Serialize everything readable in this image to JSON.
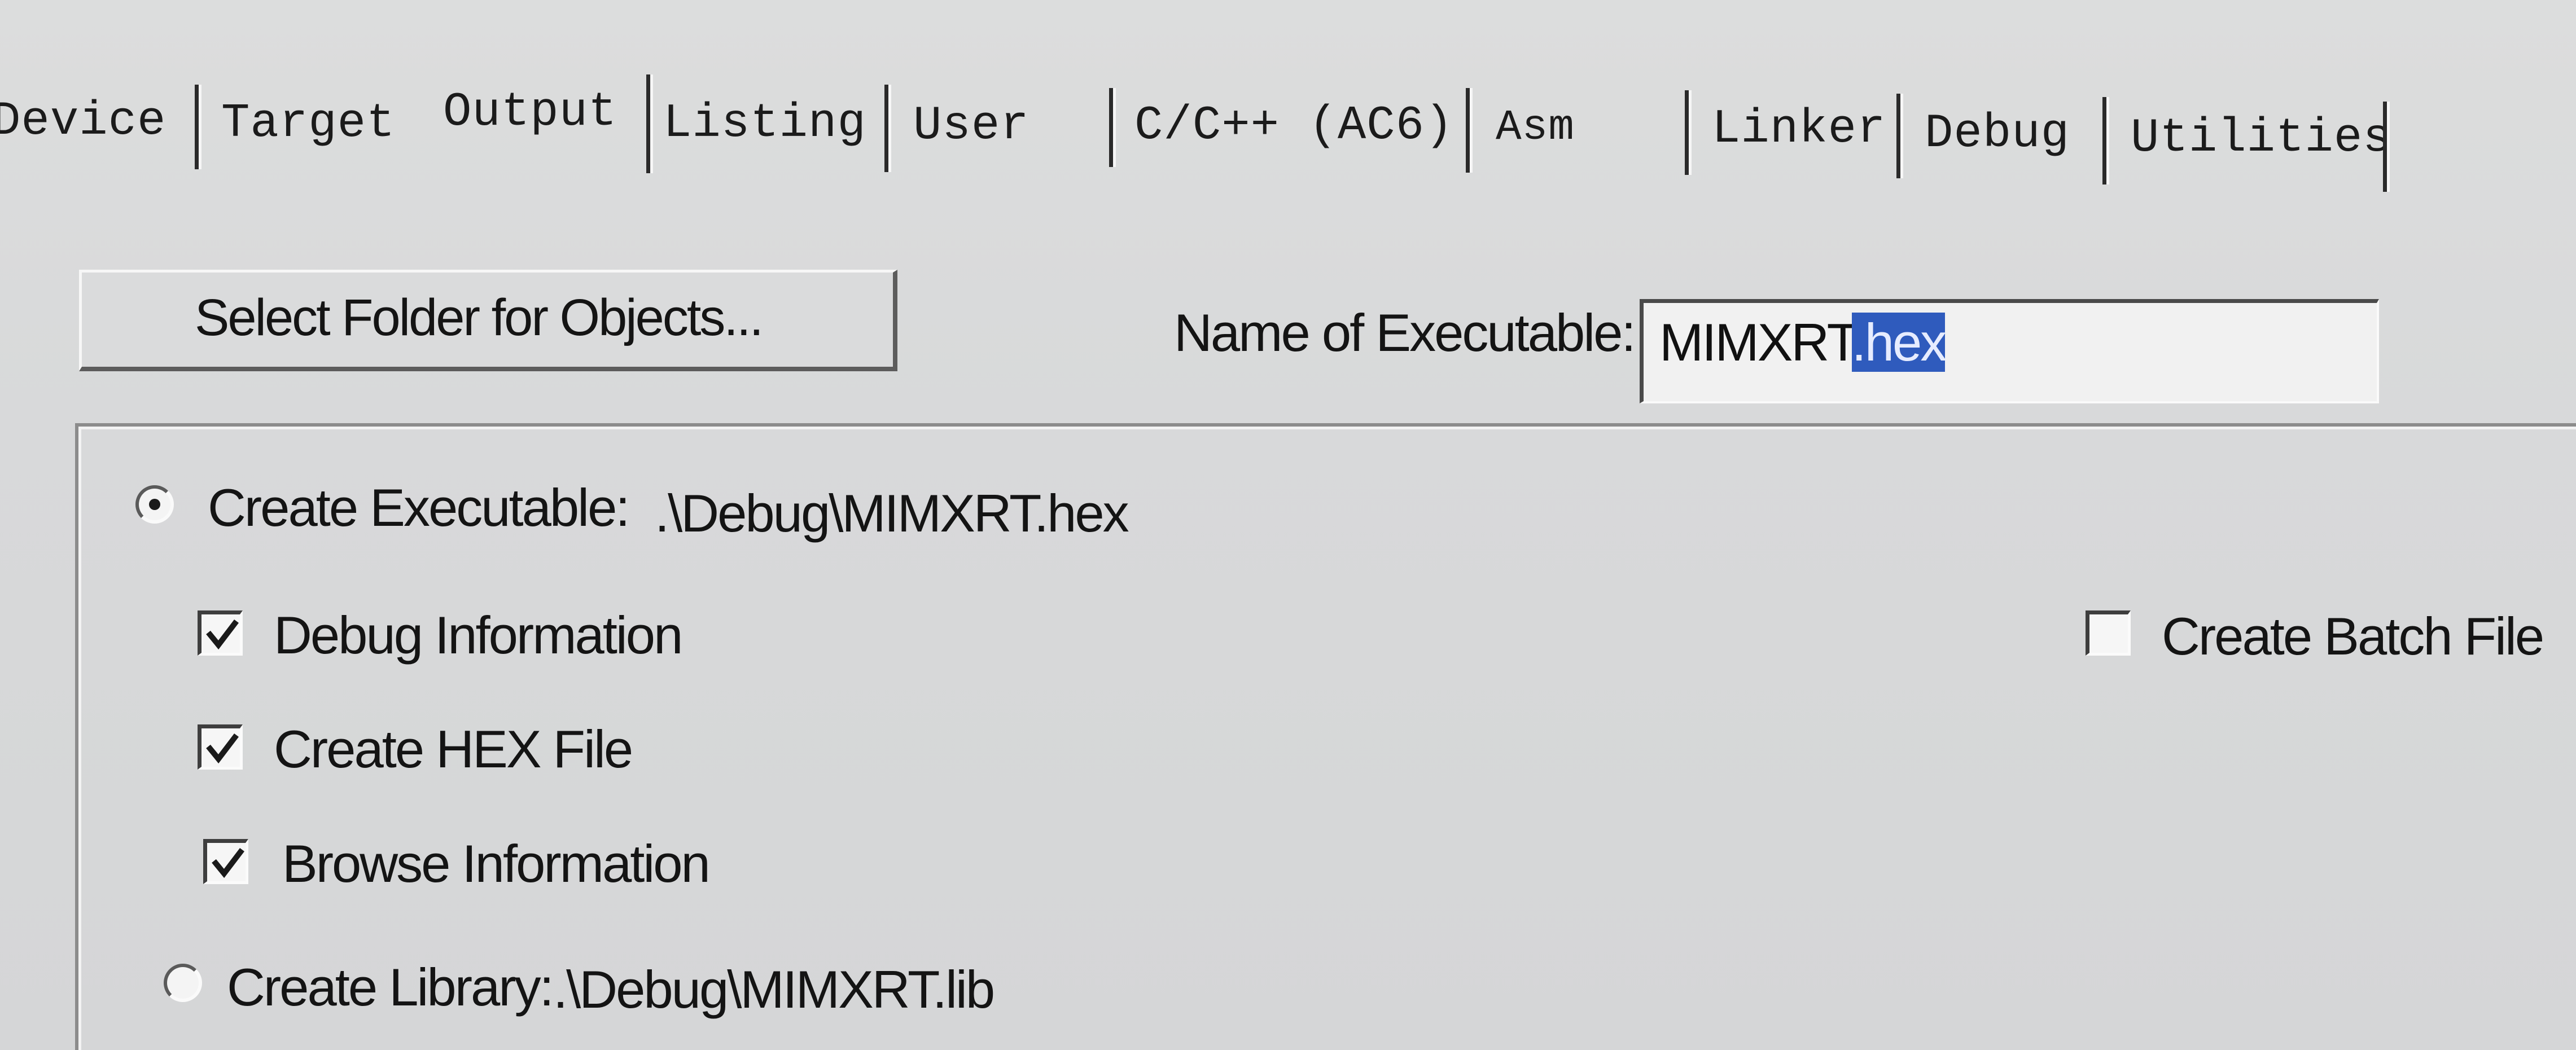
{
  "tabs": [
    {
      "label": "Device"
    },
    {
      "label": "Target"
    },
    {
      "label": "Output",
      "active": true
    },
    {
      "label": "Listing"
    },
    {
      "label": "User"
    },
    {
      "label": "C/C++ (AC6)"
    },
    {
      "label": "Asm"
    },
    {
      "label": "Linker"
    },
    {
      "label": "Debug"
    },
    {
      "label": "Utilities"
    }
  ],
  "output": {
    "select_folder_label": "Select Folder for Objects...",
    "executable_label": "Name of Executable:",
    "executable_name": "MIMXRT",
    "executable_ext_selected": ".hex",
    "create_executable_label": "Create Executable:",
    "create_executable_path": ".\\Debug\\MIMXRT.hex",
    "create_executable_selected": true,
    "debug_info_label": "Debug Information",
    "debug_info_checked": true,
    "create_hex_label": "Create HEX File",
    "create_hex_checked": true,
    "browse_info_label": "Browse Information",
    "browse_info_checked": true,
    "create_batch_label": "Create Batch File",
    "create_batch_checked": false,
    "create_library_label": "Create Library:",
    "create_library_path": ".\\Debug\\MIMXRT.lib",
    "create_library_selected": false
  },
  "colors": {
    "background": "#d7d8d9",
    "selection": "#2f5bbd",
    "text": "#141414"
  }
}
